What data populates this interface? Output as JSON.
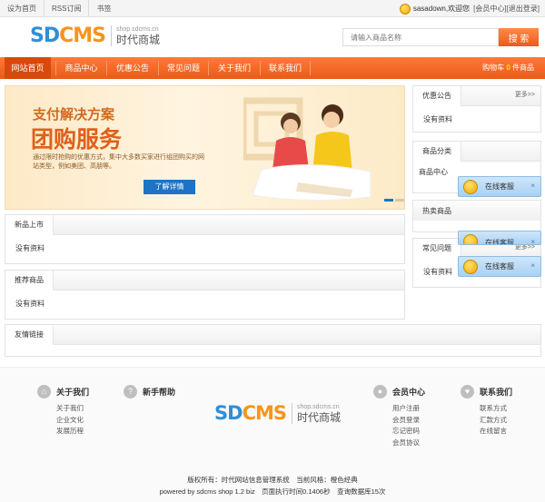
{
  "topbar": {
    "links": [
      "设为首页",
      "RSS订阅",
      "书签"
    ],
    "user_name": "sasadown,欢迎您",
    "member_center": "[会员中心]",
    "logout": "[退出登录]"
  },
  "header": {
    "logo_sd": "SD",
    "logo_cms": "CMS",
    "logo_domain": "shop.sdcms.cn",
    "logo_cn": "时代商城",
    "search_placeholder": "请输入商品名称",
    "search_button": "搜 索"
  },
  "nav": {
    "items": [
      "网站首页",
      "商品中心",
      "优惠公告",
      "常见问题",
      "关于我们",
      "联系我们"
    ],
    "cart_label": "购物车",
    "cart_count": "0",
    "cart_unit": "件商品"
  },
  "banner": {
    "title1": "支付解决方案",
    "title2": "团购服务",
    "desc": "通过限时抢购的优惠方式，集中大多数买家进行组团购买的网站类型，例如美团、高朋等。",
    "button": "了解详情"
  },
  "main": {
    "new_products": {
      "title": "新品上市",
      "empty": "没有资料"
    },
    "recommended": {
      "title": "推荐商品",
      "empty": "没有资料"
    },
    "links": {
      "title": "友情链接"
    }
  },
  "sidebar": {
    "more": "更多>>",
    "notices": {
      "title": "优惠公告",
      "empty": "没有资料"
    },
    "categories": {
      "title": "商品分类",
      "item": "商品中心"
    },
    "hot": {
      "title": "热卖商品"
    },
    "faq": {
      "title": "常见问题",
      "empty": "没有资料"
    }
  },
  "service": {
    "label": "在线客服",
    "close": "×"
  },
  "footer": {
    "about": {
      "title": "关于我们",
      "items": [
        "关于我们",
        "企业文化",
        "发展历程"
      ]
    },
    "help": {
      "title": "新手帮助"
    },
    "member": {
      "title": "会员中心",
      "items": [
        "用户注册",
        "会员登录",
        "忘记密码",
        "会员协议"
      ]
    },
    "contact": {
      "title": "联系我们",
      "items": [
        "联系方式",
        "汇款方式",
        "在线留言"
      ]
    },
    "copyright": "版权所有：时代网站信息管理系统　当前风格：橙色经典",
    "powered": "powered by sdcms shop 1.2 biz　页面执行时间0.1406秒　查询数据库15次"
  },
  "colors": {
    "accent": "#ef5a17",
    "brand_blue": "#2f8fd8",
    "brand_orange": "#f7941d"
  }
}
